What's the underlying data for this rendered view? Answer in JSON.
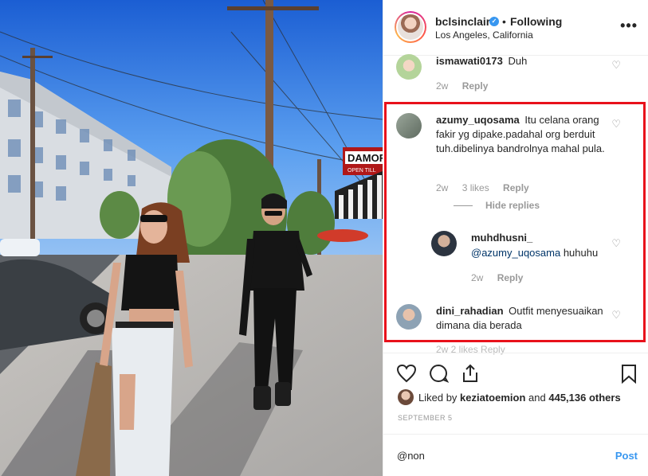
{
  "header": {
    "username": "bclsinclair",
    "separator": "•",
    "follow_status": "Following",
    "location": "Los Angeles, California",
    "more_label": "•••"
  },
  "comments": [
    {
      "user": "ismawati0173",
      "text": "Duh",
      "time": "2w",
      "reply": "Reply"
    },
    {
      "user": "azumy_uqosama",
      "text": "Itu celana orang fakir yg dipake.padahal org berduit tuh.dibelinya bandrolnya mahal pula.",
      "time": "2w",
      "likes": "3 likes",
      "reply": "Reply",
      "hide_replies": "Hide replies"
    },
    {
      "user": "muhdhusni_",
      "mention": "@azumy_uqosama",
      "text": "huhuhu",
      "time": "2w",
      "reply": "Reply"
    },
    {
      "user": "dini_rahadian",
      "text": "Outfit menyesuaikan dimana dia berada"
    }
  ],
  "cutoff_text": "2w   2 likes   Reply",
  "actions": {
    "likes_prefix": "Liked by",
    "liked_by_user": "keziatoemion",
    "likes_and": "and",
    "likes_count": "445,136 others",
    "date": "SEPTEMBER 5"
  },
  "add_comment": {
    "value": "@non",
    "post_label": "Post"
  },
  "photo": {
    "sign_text": "DAMORE PIZZA",
    "sign_sub": "OPEN TILL"
  },
  "colors": {
    "accent": "#3897f0",
    "highlight": "#e8111b",
    "muted": "#999999"
  }
}
